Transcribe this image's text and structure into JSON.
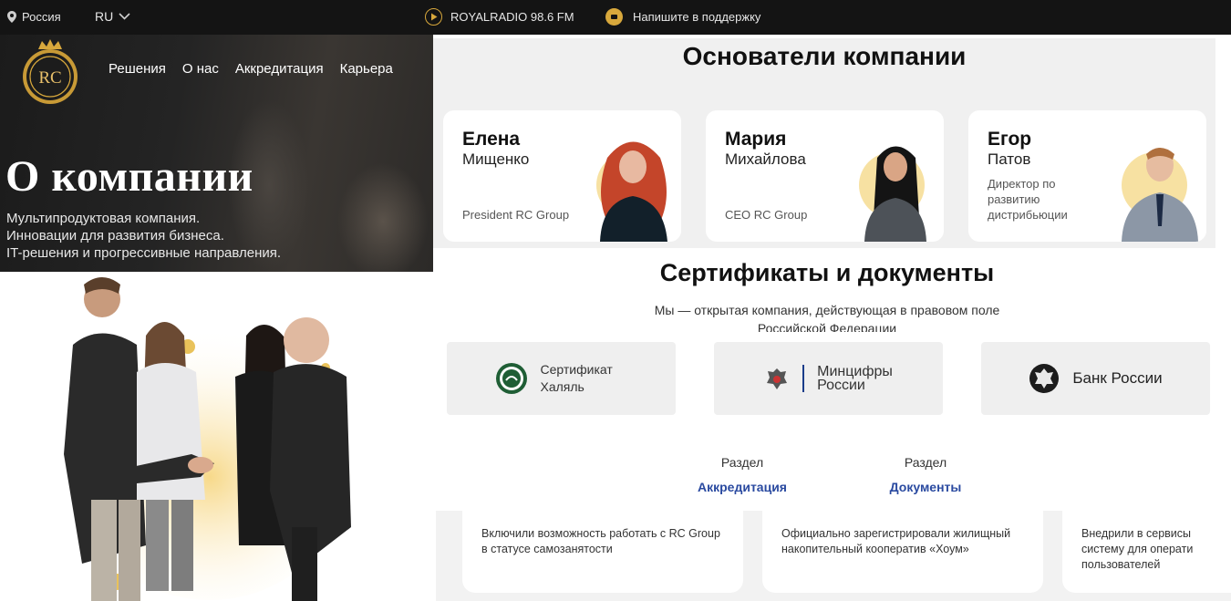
{
  "topbar": {
    "location": "Россия",
    "language": "RU",
    "radio": "ROYALRADIO 98.6 FM",
    "support": "Напишите в поддержку"
  },
  "logo": {
    "text": "RC"
  },
  "nav": {
    "items": [
      "Решения",
      "О нас",
      "Аккредитация",
      "Карьера"
    ]
  },
  "hero": {
    "title": "О компании",
    "lines": [
      "Мультипродуктовая компания.",
      "Инновации для развития бизнеса.",
      "IT-решения и прогрессивные направления."
    ]
  },
  "founders": {
    "title": "Основатели компании",
    "people": [
      {
        "first": "Елена",
        "last": "Мищенко",
        "role": "President RC Group"
      },
      {
        "first": "Мария",
        "last": "Михайлова",
        "role": "CEO RC Group"
      },
      {
        "first": "Егор",
        "last": "Патов",
        "role": "Директор по развитию дистрибьюции"
      }
    ]
  },
  "certificates": {
    "title": "Сертификаты и документы",
    "intro": "Мы — открытая компания, действующая в правовом поле Российской Федерации",
    "items": [
      {
        "label": "Сертификат Халяль"
      },
      {
        "label_line1": "Минцифры",
        "label_line2": "России"
      },
      {
        "label": "Банк России"
      }
    ],
    "links": [
      {
        "caption": "Раздел",
        "link": "Аккредитация"
      },
      {
        "caption": "Раздел",
        "link": "Документы"
      }
    ]
  },
  "news": [
    {
      "text": "Включили возможность работать с RC Group в статусе самозанятости"
    },
    {
      "text": "Официально зарегистрировали жилищный накопительный кооператив «Хоум»"
    },
    {
      "text": "Внедрили в сервисы систему для операти пользователей"
    }
  ],
  "colors": {
    "accent_gold": "#d8a83c",
    "link_blue": "#2a4aa0",
    "topbar_bg": "#141414",
    "section_bg": "#f0f0f0"
  }
}
